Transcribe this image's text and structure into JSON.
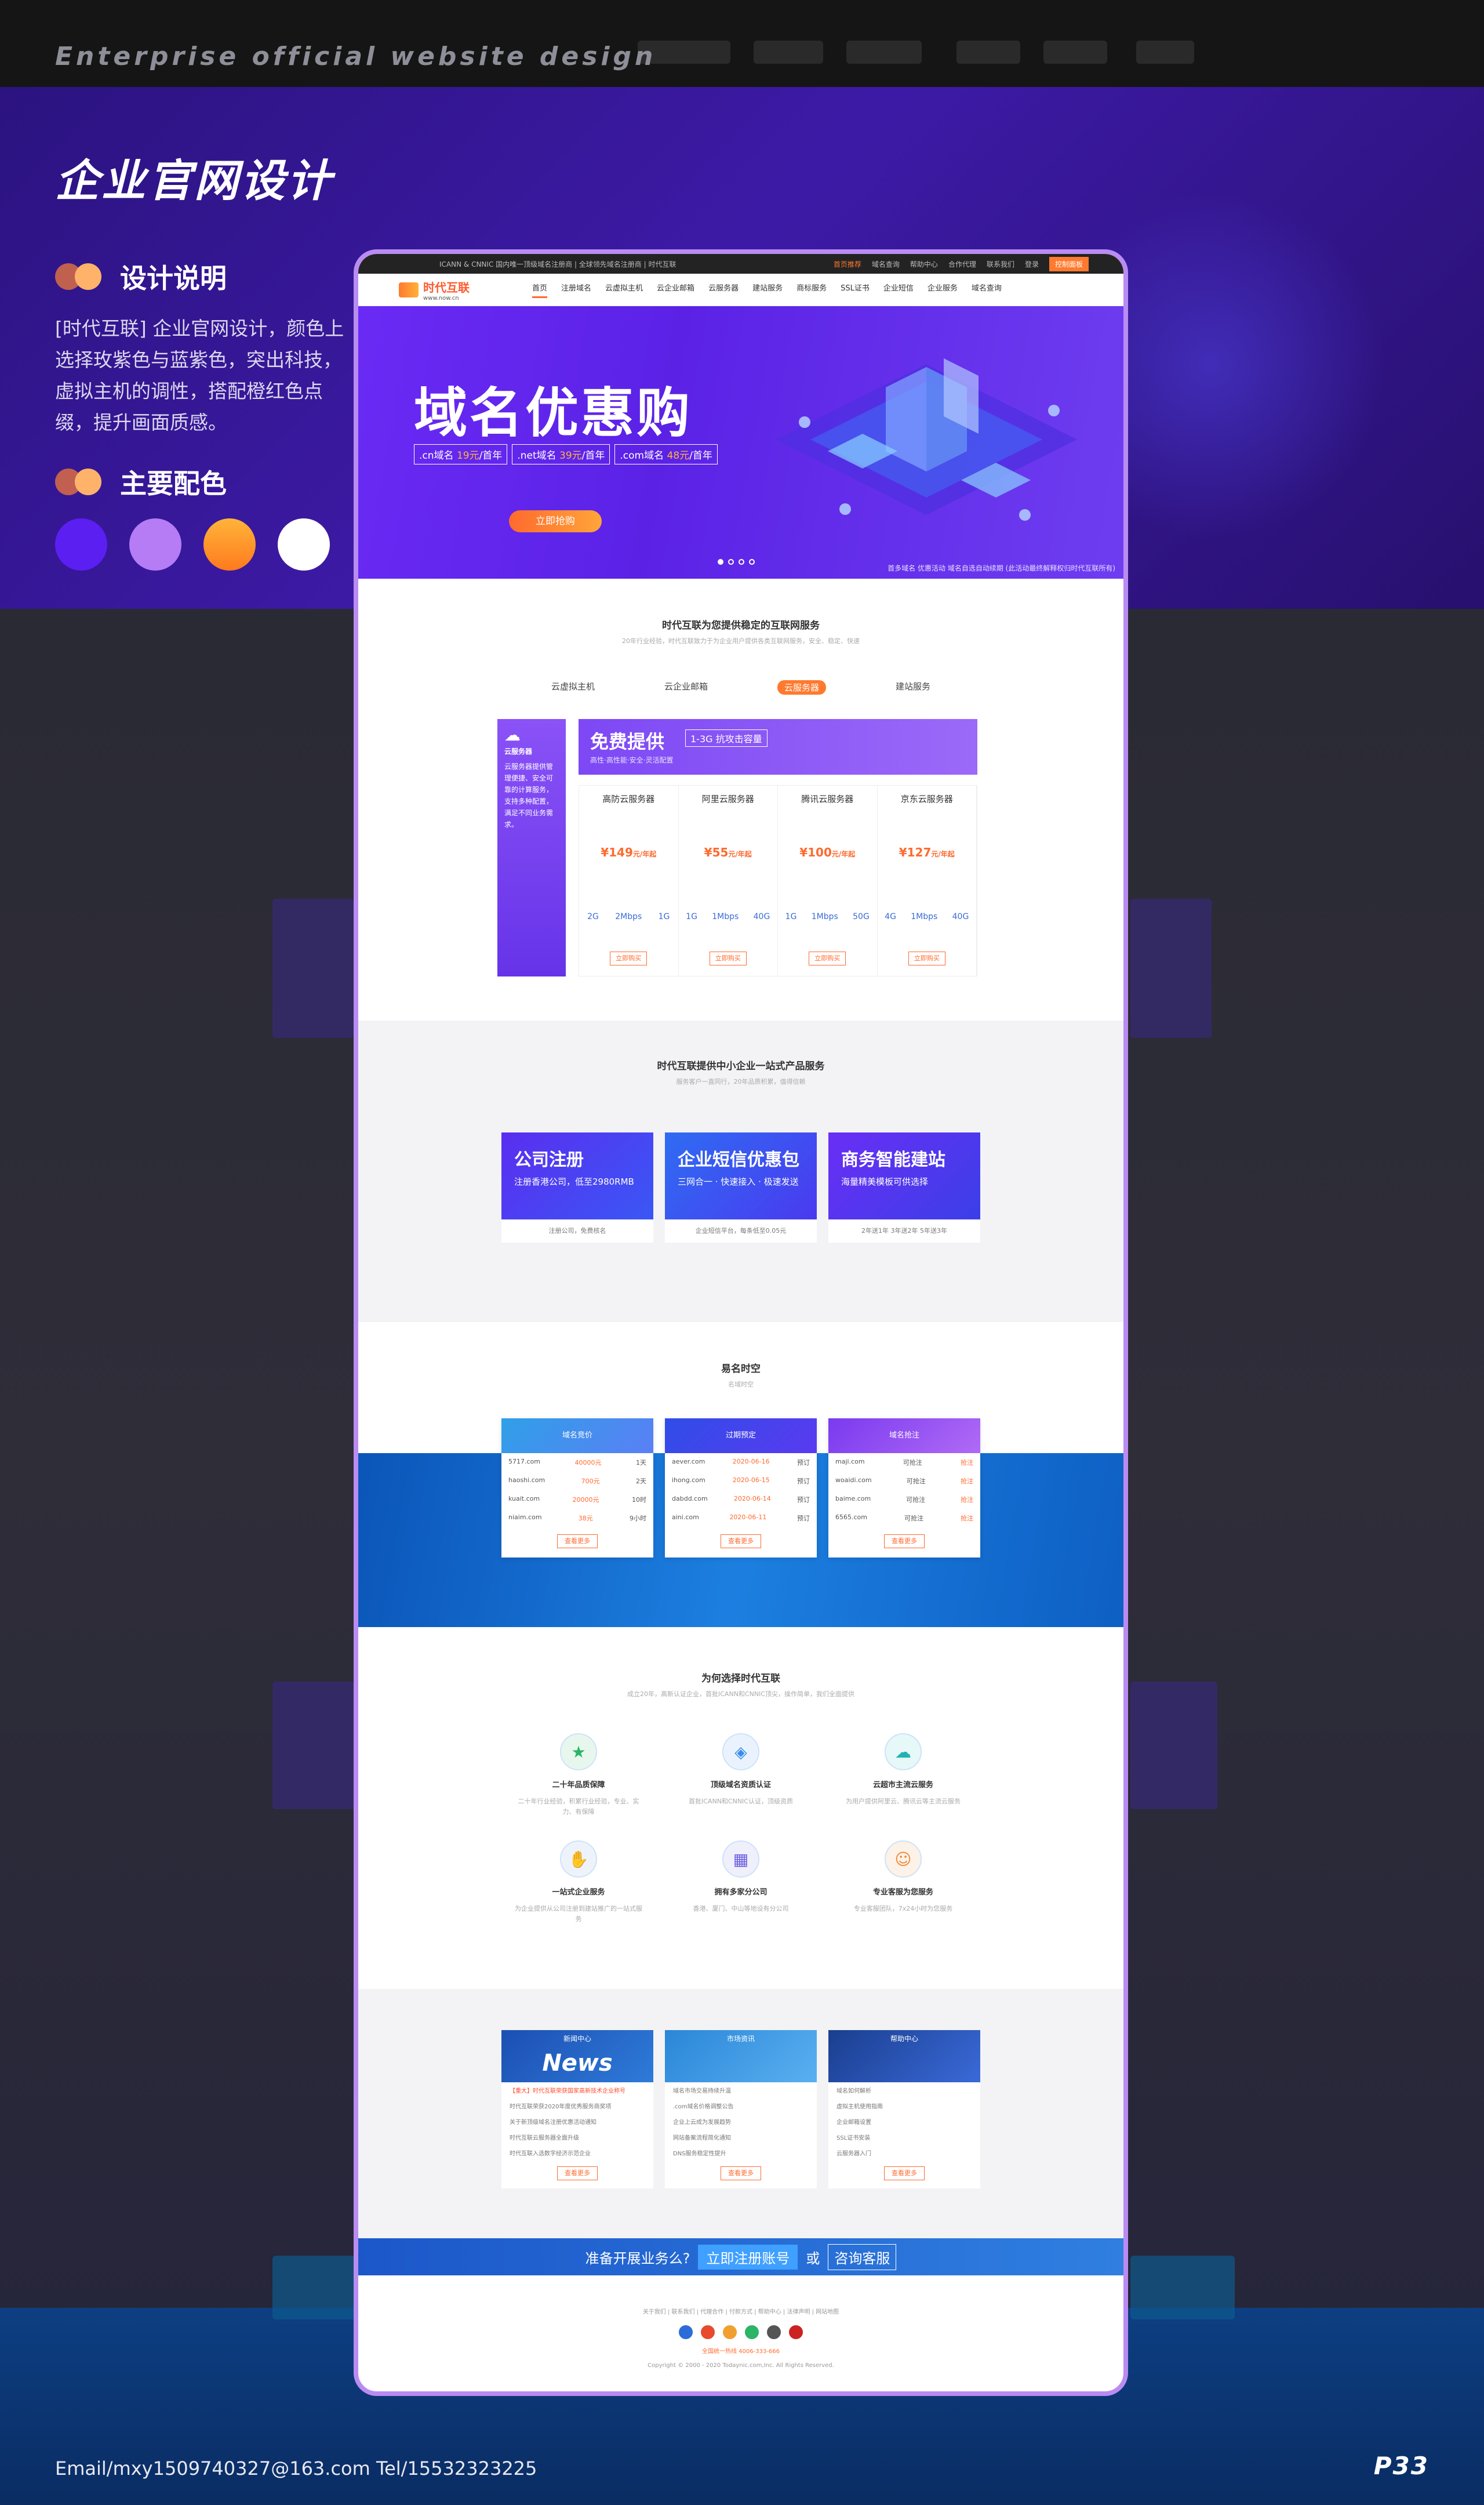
{
  "header_en": "Enterprise official website design",
  "title": "企业官网设计",
  "design": {
    "label": "设计说明",
    "text": "[时代互联] 企业官网设计，颜色上选择玫紫色与蓝紫色，突出科技，虚拟主机的调性，搭配橙红色点缀，提升画面质感。"
  },
  "palette": {
    "label": "主要配色",
    "colors": [
      "#5b1ff2",
      "#b57cf6",
      "#ff8a1e",
      "#ffffff"
    ]
  },
  "contact": "Email/mxy1509740327@163.com      Tel/15532323225",
  "page_no": "P33",
  "site": {
    "topbar": {
      "left": "ICANN & CNNIC 国内唯一顶级域名注册商 | 全球领先域名注册商 | 时代互联",
      "links": [
        "首页推荐",
        "域名查询",
        "帮助中心",
        "合作代理",
        "联系我们",
        "登录",
        "控制面板"
      ]
    },
    "logo_name": "时代互联",
    "logo_url": "www.now.cn",
    "nav": [
      "首页",
      "注册域名",
      "云虚拟主机",
      "云企业邮箱",
      "云服务器",
      "建站服务",
      "商标服务",
      "SSL证书",
      "企业短信",
      "企业服务",
      "域名查询"
    ],
    "banner": {
      "headline": "域名优惠购",
      "prices": [
        {
          "ext": ".cn域名",
          "price": "19元",
          "unit": "/首年"
        },
        {
          "ext": ".net域名",
          "price": "39元",
          "unit": "/首年"
        },
        {
          "ext": ".com域名",
          "price": "48元",
          "unit": "/首年"
        }
      ],
      "cta": "立即抢购",
      "note": "首多域名 优惠活动 域名自选自动续期 (此活动最终解释权归时代互联所有)"
    },
    "stable": {
      "title": "时代互联为您提供稳定的互联网服务",
      "sub": "20年行业经验，时代互联致力于为企业用户提供各类互联网服务，安全、稳定、快速",
      "tabs": [
        "云虚拟主机",
        "云企业邮箱",
        "云服务器",
        "建站服务"
      ],
      "side_title": "云服务器",
      "side_text": "云服务器提供管理便捷、安全可靠的计算服务，支持多种配置，满足不同业务需求。",
      "top_title": "免费提供",
      "top_cap": "1-3G",
      "top_cap2": "抗攻击容量",
      "top_sub": "高性·高性能·安全·灵活配置",
      "cards": [
        {
          "name": "高防云服务器",
          "price": "¥149",
          "unit": "元/年起",
          "specs": [
            "2G",
            "2Mbps",
            "1G"
          ]
        },
        {
          "name": "阿里云服务器",
          "price": "¥55",
          "unit": "元/年起",
          "specs": [
            "1G",
            "1Mbps",
            "40G"
          ]
        },
        {
          "name": "腾讯云服务器",
          "price": "¥100",
          "unit": "元/年起",
          "specs": [
            "1G",
            "1Mbps",
            "50G"
          ]
        },
        {
          "name": "京东云服务器",
          "price": "¥127",
          "unit": "元/年起",
          "specs": [
            "4G",
            "1Mbps",
            "40G"
          ]
        }
      ],
      "buy": "立即购买"
    },
    "one_stop": {
      "title": "时代互联提供中小企业一站式产品服务",
      "sub": "服务客户一直同行，20年品质积累，值得信赖",
      "cards": [
        {
          "title": "公司注册",
          "sub": "注册香港公司，低至2980RMB",
          "cap": "注册公司，免费核名"
        },
        {
          "title": "企业短信优惠包",
          "sub": "三网合一 · 快速接入 · 极速发送",
          "cap": "企业短信平台，每条低至0.05元"
        },
        {
          "title": "商务智能建站",
          "sub": "海量精美模板可供选择",
          "cap": "2年送1年 3年送2年 5年送3年"
        }
      ]
    },
    "domains": {
      "title": "易名时空",
      "sub": "名域时空",
      "cards": [
        {
          "head": "域名竞价",
          "rows": [
            [
              "5717.com",
              "40000元",
              "1天"
            ],
            [
              "haoshi.com",
              "700元",
              "2天"
            ],
            [
              "kuait.com",
              "20000元",
              "10时"
            ],
            [
              "niaim.com",
              "38元",
              "9小时"
            ]
          ]
        },
        {
          "head": "过期预定",
          "rows": [
            [
              "aever.com",
              "2020-06-16",
              "预订"
            ],
            [
              "ihong.com",
              "2020-06-15",
              "预订"
            ],
            [
              "dabdd.com",
              "2020-06-14",
              "预订"
            ],
            [
              "aini.com",
              "2020-06-11",
              "预订"
            ]
          ]
        },
        {
          "head": "域名抢注",
          "rows": [
            [
              "maji.com",
              "可抢注",
              "抢注"
            ],
            [
              "woaidi.com",
              "可抢注",
              "抢注"
            ],
            [
              "baime.com",
              "可抢注",
              "抢注"
            ],
            [
              "6565.com",
              "可抢注",
              "抢注"
            ]
          ]
        }
      ],
      "more": "查看更多"
    },
    "why": {
      "title": "为何选择时代互联",
      "sub": "成立20年，高新认证企业，首批ICANN和CNNIC顶尖，操作简单，我们全面提供",
      "items": [
        {
          "icon": "trophy-icon",
          "t": "二十年品质保障",
          "d": "二十年行业经验，积累行业经验，专业、实力、有保障"
        },
        {
          "icon": "shield-icon",
          "t": "顶级域名资质认证",
          "d": "首批ICANN和CNNIC认证，顶级资质"
        },
        {
          "icon": "cloud-icon",
          "t": "云超市主流云服务",
          "d": "为用户提供阿里云、腾讯云等主流云服务"
        },
        {
          "icon": "handshake-icon",
          "t": "一站式企业服务",
          "d": "为企业提供从公司注册到建站推广的一站式服务"
        },
        {
          "icon": "building-icon",
          "t": "拥有多家分公司",
          "d": "香港、厦门、中山等地设有分公司"
        },
        {
          "icon": "support-icon",
          "t": "专业客服为您服务",
          "d": "专业客服团队，7x24小时为您服务"
        }
      ]
    },
    "news": {
      "cards": [
        {
          "head": "新闻中心",
          "big": "News",
          "items": [
            "【重大】时代互联荣获国家高新技术企业称号",
            "时代互联荣获2020年度优秀服务商奖项",
            "关于新顶级域名注册优惠活动通知",
            "时代互联云服务器全面升级",
            "时代互联入选数字经济示范企业"
          ]
        },
        {
          "head": "市场资讯",
          "big": "",
          "items": [
            "域名市场交易持续升温",
            ".com域名价格调整公告",
            "企业上云成为发展趋势",
            "网站备案流程简化通知",
            "DNS服务稳定性提升"
          ]
        },
        {
          "head": "帮助中心",
          "big": "",
          "items": [
            "域名如何解析",
            "虚拟主机使用指南",
            "企业邮箱设置",
            "SSL证书安装",
            "云服务器入门"
          ]
        }
      ],
      "more": "查看更多"
    },
    "cta_bar": {
      "q": "准备开展业务么?",
      "b1": "立即注册账号",
      "or": "或",
      "b2": "咨询客服"
    },
    "footer": {
      "links": "关于我们 | 联系我们 | 代理合作 | 付款方式 | 帮助中心 | 法律声明 | 网站地图",
      "hotline": "全国统一热线 4006-333-666",
      "copyright": "Copyright © 2000 - 2020 Todaynic.com,Inc. All Rights Reserved."
    }
  }
}
